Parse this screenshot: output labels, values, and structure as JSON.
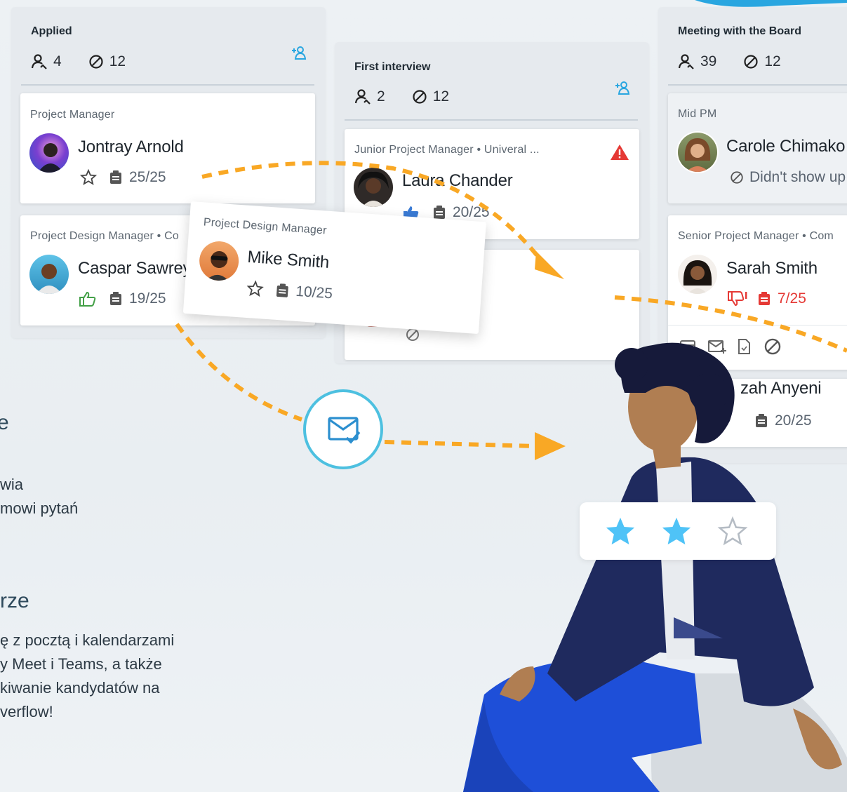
{
  "columns": [
    {
      "title": "Applied",
      "candidates": "4",
      "rejected": "12"
    },
    {
      "title": "First interview",
      "candidates": "2",
      "rejected": "12"
    },
    {
      "title": "Meeting with the Board",
      "candidates": "39",
      "rejected": "12"
    }
  ],
  "cards": [
    {
      "role": "Project Manager",
      "name": "Jontray Arnold",
      "score": "25/25"
    },
    {
      "role": "Project Design Manager • Co",
      "name": "Caspar Sawrey",
      "score": "19/25"
    },
    {
      "role": "Junior Project Manager • Univeral ...",
      "name": "Laura Chander",
      "score": "20/25"
    },
    {
      "role": "Mid PM",
      "name": "Carole Chimako",
      "status": "Didn't show up"
    },
    {
      "role": "Senior Project Manager • Com",
      "name": "Sarah Smith",
      "score": "7/25"
    },
    {
      "name": "zah Anyeni",
      "score": "20/25"
    }
  ],
  "dragged_card": {
    "role": "Project Design Manager",
    "name": "Mike Smith",
    "score": "10/25"
  },
  "left_text": {
    "line1": "e",
    "line2": "wia",
    "line3": "mowi pytań",
    "heading": "rze",
    "para1": "ę z pocztą i kalendarzami",
    "para2": "y Meet i Teams, a także",
    "para3": "kiwanie kandydatów na",
    "para4": "verflow!"
  },
  "rating": {
    "filled": 2,
    "total": 3
  },
  "colors": {
    "accent": "#29b6f6",
    "arrow": "#f9a825",
    "danger": "#e53935",
    "star": "#4fc3f7",
    "navy": "#1f2a5e",
    "blue": "#1e4fd8"
  }
}
